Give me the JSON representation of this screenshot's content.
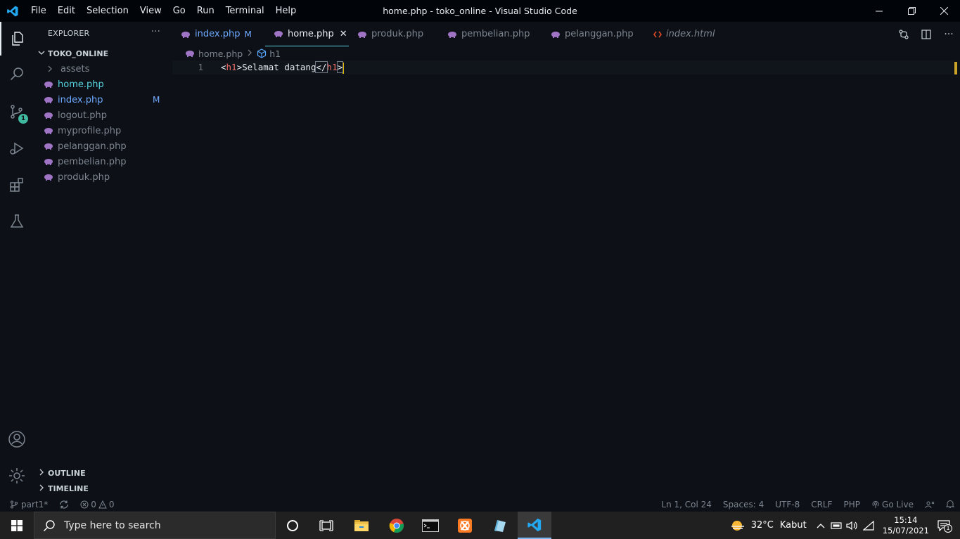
{
  "titlebar": {
    "menu": [
      "File",
      "Edit",
      "Selection",
      "View",
      "Go",
      "Run",
      "Terminal",
      "Help"
    ],
    "title": "home.php - toko_online - Visual Studio Code"
  },
  "activitybar": {
    "icons": [
      "explorer-icon",
      "search-icon",
      "source-control-icon",
      "run-debug-icon",
      "extensions-icon",
      "testing-icon",
      "accounts-icon",
      "settings-gear-icon"
    ],
    "scm_badge": "1"
  },
  "sidebar": {
    "header": "EXPLORER",
    "more": "···",
    "folder": "TOKO_ONLINE",
    "items": [
      {
        "label": "assets",
        "type": "folder",
        "mark": ""
      },
      {
        "label": "home.php",
        "type": "php",
        "mark": ""
      },
      {
        "label": "index.php",
        "type": "php",
        "mark": "M"
      },
      {
        "label": "logout.php",
        "type": "php",
        "mark": ""
      },
      {
        "label": "myprofile.php",
        "type": "php",
        "mark": ""
      },
      {
        "label": "pelanggan.php",
        "type": "php",
        "mark": ""
      },
      {
        "label": "pembelian.php",
        "type": "php",
        "mark": ""
      },
      {
        "label": "produk.php",
        "type": "php",
        "mark": ""
      }
    ],
    "outline": "OUTLINE",
    "timeline": "TIMELINE"
  },
  "tabs": [
    {
      "label": "index.php",
      "mark": "M"
    },
    {
      "label": "home.php",
      "close": "✕"
    },
    {
      "label": "produk.php"
    },
    {
      "label": "pembelian.php"
    },
    {
      "label": "pelanggan.php"
    },
    {
      "label": "index.html"
    }
  ],
  "breadcrumb": {
    "file": "home.php",
    "symbol": "h1"
  },
  "editor": {
    "line_number": "1",
    "code": {
      "open_lt": "<",
      "open_tag": "h1",
      "open_gt": ">",
      "text": "Selamat datang",
      "close_lt": "</",
      "close_tag": "h1",
      "close_gt": ">"
    }
  },
  "statusbar": {
    "branch": "part1*",
    "errors": "0",
    "warnings": "0",
    "position": "Ln 1, Col 24",
    "spaces": "Spaces: 4",
    "encoding": "UTF-8",
    "eol": "CRLF",
    "language": "PHP",
    "golive": "Go Live"
  },
  "taskbar": {
    "search_placeholder": "Type here to search",
    "weather_temp": "32°C",
    "weather_desc": "Kabut",
    "time": "15:14",
    "date": "15/07/2021",
    "notif_count": "1"
  },
  "colors": {
    "php_icon": "#a074c4",
    "html_icon": "#e44d26",
    "accent": "#56d4e0",
    "modified": "#6ea8fe"
  }
}
